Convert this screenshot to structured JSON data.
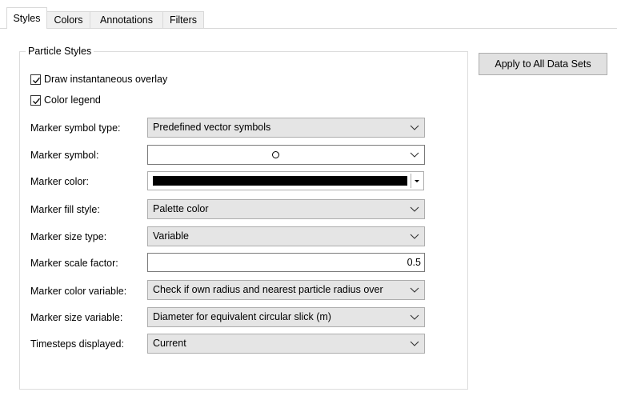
{
  "tabs": [
    {
      "label": "Styles",
      "active": true
    },
    {
      "label": "Colors",
      "active": false
    },
    {
      "label": "Annotations",
      "active": false
    },
    {
      "label": "Filters",
      "active": false
    }
  ],
  "group": {
    "title": "Particle Styles",
    "checkboxes": [
      {
        "label": "Draw instantaneous overlay",
        "checked": true
      },
      {
        "label": "Color legend",
        "checked": true
      }
    ]
  },
  "fields": {
    "marker_symbol_type": {
      "label": "Marker symbol type:",
      "value": "Predefined vector symbols"
    },
    "marker_symbol": {
      "label": "Marker symbol:",
      "value_icon": "circle-symbol-icon"
    },
    "marker_color": {
      "label": "Marker color:",
      "color": "#000000"
    },
    "marker_fill_style": {
      "label": "Marker fill style:",
      "value": "Palette color"
    },
    "marker_size_type": {
      "label": "Marker size type:",
      "value": "Variable"
    },
    "marker_scale_factor": {
      "label": "Marker scale factor:",
      "value": "0.5"
    },
    "marker_color_variable": {
      "label": "Marker color variable:",
      "value": "Check if own radius and nearest particle radius over"
    },
    "marker_size_variable": {
      "label": "Marker size variable:",
      "value": "Diameter for equivalent circular slick (m)"
    },
    "timesteps_displayed": {
      "label": "Timesteps displayed:",
      "value": "Current"
    }
  },
  "apply_button": {
    "label": "Apply to All Data Sets"
  },
  "colors": {
    "combo_bg": "#e5e5e5",
    "button_bg": "#e1e1e1",
    "border": "#adadad"
  }
}
